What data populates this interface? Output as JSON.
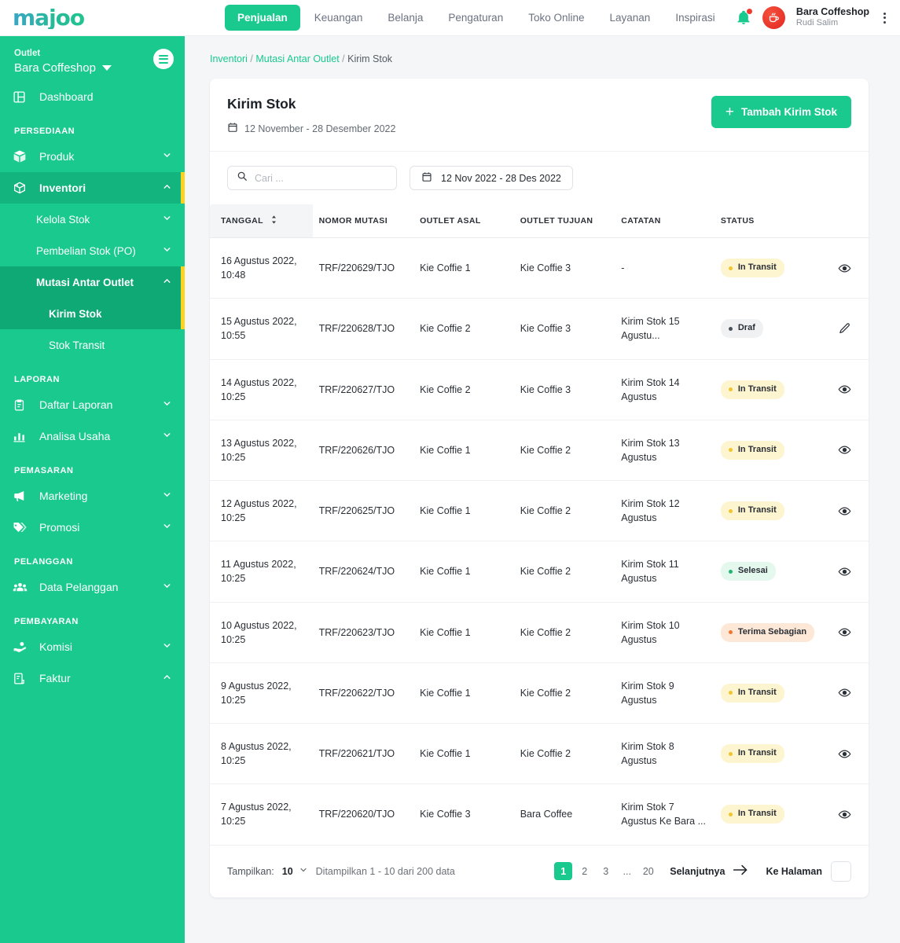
{
  "topbar": {
    "logo_text": "majoo",
    "nav": [
      {
        "label": "Penjualan",
        "active": true
      },
      {
        "label": "Keuangan",
        "active": false
      },
      {
        "label": "Belanja",
        "active": false
      },
      {
        "label": "Pengaturan",
        "active": false
      },
      {
        "label": "Toko Online",
        "active": false
      },
      {
        "label": "Layanan",
        "active": false
      },
      {
        "label": "Inspirasi",
        "active": false
      }
    ],
    "bell_icon": "bell-icon",
    "user_name": "Bara Coffeshop",
    "user_role": "Rudi Salim"
  },
  "sidebar": {
    "outlet_label": "Outlet",
    "outlet_name": "Bara Coffeshop",
    "items": [
      {
        "label": "Dashboard",
        "icon": "dashboard-icon",
        "type": "item"
      },
      {
        "label": "PERSEDIAAN",
        "type": "group"
      },
      {
        "label": "Produk",
        "icon": "box-icon",
        "type": "item",
        "chevron": "down"
      },
      {
        "label": "Inventori",
        "icon": "inventory-icon",
        "type": "item",
        "chevron": "up",
        "active": true,
        "accent": true
      },
      {
        "label": "Kelola Stok",
        "type": "sub",
        "chevron": "down"
      },
      {
        "label": "Pembelian Stok (PO)",
        "type": "sub",
        "chevron": "down"
      },
      {
        "label": "Mutasi Antar Outlet",
        "type": "sub",
        "chevron": "up",
        "active": true,
        "accent": true
      },
      {
        "label": "Kirim Stok",
        "type": "sub2",
        "active": true,
        "accent": true
      },
      {
        "label": "Stok Transit",
        "type": "sub2"
      },
      {
        "label": "LAPORAN",
        "type": "group"
      },
      {
        "label": "Daftar Laporan",
        "icon": "clipboard-icon",
        "type": "item",
        "chevron": "down"
      },
      {
        "label": "Analisa Usaha",
        "icon": "chart-icon",
        "type": "item",
        "chevron": "down"
      },
      {
        "label": "PEMASARAN",
        "type": "group"
      },
      {
        "label": "Marketing",
        "icon": "megaphone-icon",
        "type": "item",
        "chevron": "down"
      },
      {
        "label": "Promosi",
        "icon": "tag-icon",
        "type": "item",
        "chevron": "down"
      },
      {
        "label": "PELANGGAN",
        "type": "group"
      },
      {
        "label": "Data Pelanggan",
        "icon": "people-icon",
        "type": "item",
        "chevron": "down"
      },
      {
        "label": "PEMBAYARAN",
        "type": "group"
      },
      {
        "label": "Komisi",
        "icon": "hand-coin-icon",
        "type": "item",
        "chevron": "down"
      },
      {
        "label": "Faktur",
        "icon": "invoice-icon",
        "type": "item",
        "chevron": "up"
      }
    ]
  },
  "breadcrumb": {
    "item1": "Inventori",
    "item2": "Mutasi Antar Outlet",
    "item3": "Kirim Stok",
    "sep": "/"
  },
  "card": {
    "title": "Kirim Stok",
    "date_range": "12 November - 28 Desember 2022",
    "add_button": "Tambah Kirim Stok",
    "plus": "+"
  },
  "filters": {
    "search_placeholder": "Cari ...",
    "search_value": "",
    "date_filter": "12 Nov 2022 - 28 Des 2022"
  },
  "table": {
    "columns": [
      "TANGGAL",
      "NOMOR MUTASI",
      "OUTLET ASAL",
      "OUTLET TUJUAN",
      "CATATAN",
      "STATUS",
      ""
    ],
    "rows": [
      {
        "tanggal": "16 Agustus 2022, 10:48",
        "nomor": "TRF/220629/TJO",
        "asal": "Kie Coffie 1",
        "tujuan": "Kie Coffie 3",
        "catatan": "-",
        "status": "In Transit",
        "status_kind": "transit",
        "action": "view-icon"
      },
      {
        "tanggal": "15 Agustus 2022, 10:55",
        "nomor": "TRF/220628/TJO",
        "asal": "Kie Coffie 2",
        "tujuan": "Kie Coffie 3",
        "catatan": "Kirim Stok 15 Agustu...",
        "status": "Draf",
        "status_kind": "draf",
        "action": "edit-icon"
      },
      {
        "tanggal": "14 Agustus 2022, 10:25",
        "nomor": "TRF/220627/TJO",
        "asal": "Kie Coffie 2",
        "tujuan": "Kie Coffie 3",
        "catatan": "Kirim Stok 14 Agustus",
        "status": "In Transit",
        "status_kind": "transit",
        "action": "view-icon"
      },
      {
        "tanggal": "13 Agustus 2022, 10:25",
        "nomor": "TRF/220626/TJO",
        "asal": "Kie Coffie 1",
        "tujuan": "Kie Coffie 2",
        "catatan": "Kirim Stok 13 Agustus",
        "status": "In Transit",
        "status_kind": "transit",
        "action": "view-icon"
      },
      {
        "tanggal": "12 Agustus 2022, 10:25",
        "nomor": "TRF/220625/TJO",
        "asal": "Kie Coffie 1",
        "tujuan": "Kie Coffie 2",
        "catatan": "Kirim Stok 12 Agustus",
        "status": "In Transit",
        "status_kind": "transit",
        "action": "view-icon"
      },
      {
        "tanggal": "11 Agustus 2022, 10:25",
        "nomor": "TRF/220624/TJO",
        "asal": "Kie Coffie 1",
        "tujuan": "Kie Coffie 2",
        "catatan": "Kirim Stok 11 Agustus",
        "status": "Selesai",
        "status_kind": "selesai",
        "action": "view-icon"
      },
      {
        "tanggal": "10 Agustus 2022, 10:25",
        "nomor": "TRF/220623/TJO",
        "asal": "Kie Coffie 1",
        "tujuan": "Kie Coffie 2",
        "catatan": "Kirim Stok 10 Agustus",
        "status": "Terima Sebagian",
        "status_kind": "sebagian",
        "action": "view-icon"
      },
      {
        "tanggal": "9 Agustus 2022, 10:25",
        "nomor": "TRF/220622/TJO",
        "asal": "Kie Coffie 1",
        "tujuan": "Kie Coffie 2",
        "catatan": "Kirim Stok 9 Agustus",
        "status": "In Transit",
        "status_kind": "transit",
        "action": "view-icon"
      },
      {
        "tanggal": "8 Agustus 2022, 10:25",
        "nomor": "TRF/220621/TJO",
        "asal": "Kie Coffie 1",
        "tujuan": "Kie Coffie 2",
        "catatan": "Kirim Stok 8 Agustus",
        "status": "In Transit",
        "status_kind": "transit",
        "action": "view-icon"
      },
      {
        "tanggal": "7 Agustus 2022, 10:25",
        "nomor": "TRF/220620/TJO",
        "asal": "Kie Coffie 3",
        "tujuan": "Bara Coffee",
        "catatan": "Kirim Stok 7 Agustus Ke Bara ...",
        "status": "In Transit",
        "status_kind": "transit",
        "action": "view-icon"
      }
    ]
  },
  "pagination": {
    "show_label": "Tampilkan:",
    "show_value": "10",
    "info": "Ditampilkan 1 - 10 dari 200 data",
    "pages": [
      "1",
      "2",
      "3",
      "...",
      "20"
    ],
    "current_page": "1",
    "next_label": "Selanjutnya",
    "goto_label": "Ke Halaman",
    "goto_value": ""
  },
  "colors": {
    "brand_green": "#19c98d",
    "accent_yellow": "#ffd21f",
    "badge_transit": "#fdf5cf",
    "badge_selesai": "#e4f8ee",
    "badge_sebagian": "#fde8d8",
    "badge_draf": "#f0f1f3"
  }
}
